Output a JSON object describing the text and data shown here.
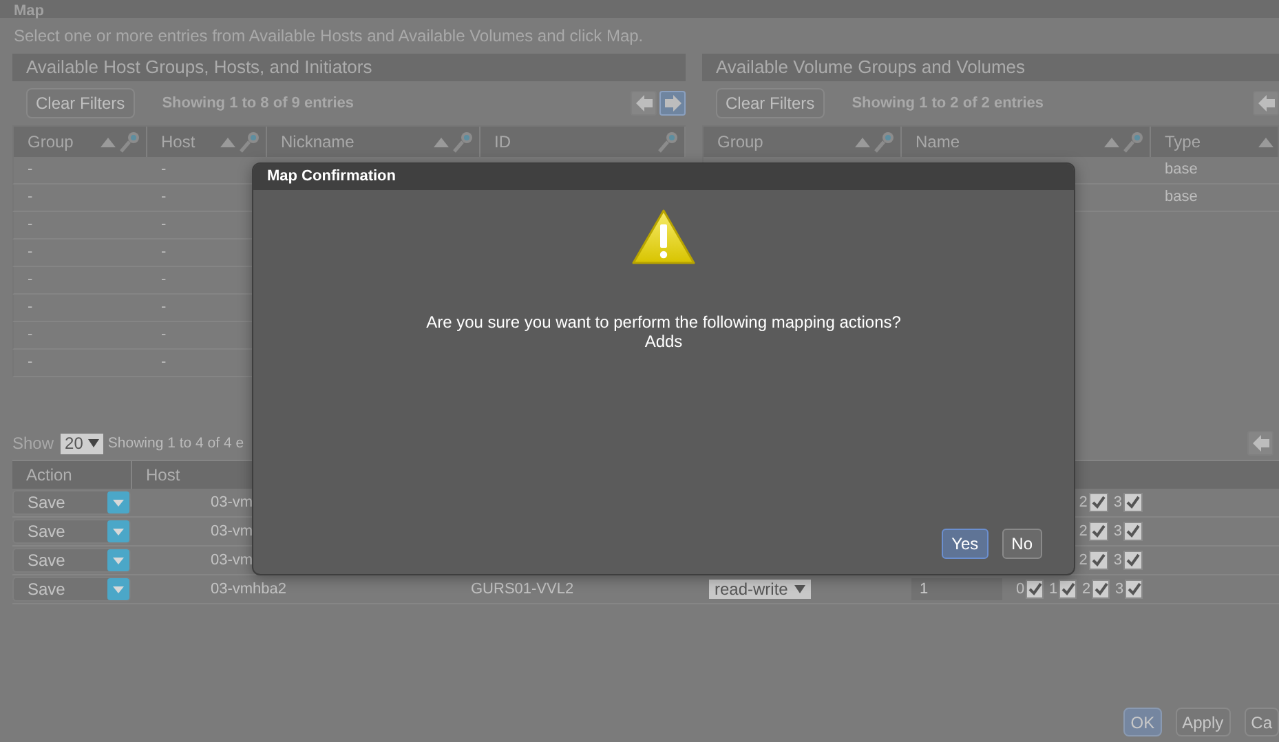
{
  "page": {
    "title": "Map",
    "instructions": "Select one or more entries from Available Hosts and Available Volumes and click Map."
  },
  "host_panel": {
    "title": "Available Host Groups, Hosts, and Initiators",
    "clear_filters": "Clear Filters",
    "info": "Showing 1 to 8 of 9 entries",
    "nav": [
      {
        "kind": "prev",
        "disabled": true
      },
      {
        "kind": "next",
        "disabled": false
      }
    ],
    "columns": [
      {
        "label": "Group",
        "sortable": true,
        "filter": true
      },
      {
        "label": "Host",
        "sortable": true,
        "filter": true
      },
      {
        "label": "Nickname",
        "sortable": true,
        "filter": true
      },
      {
        "label": "ID",
        "sortable": false,
        "filter": true
      }
    ],
    "rows": [
      [
        "-",
        "-"
      ],
      [
        "-",
        "-"
      ],
      [
        "-",
        "-"
      ],
      [
        "-",
        "-"
      ],
      [
        "-",
        "-"
      ],
      [
        "-",
        "-"
      ],
      [
        "-",
        "-"
      ],
      [
        "-",
        "-"
      ]
    ]
  },
  "volume_panel": {
    "title": "Available Volume Groups and Volumes",
    "clear_filters": "Clear Filters",
    "info": "Showing 1 to 2 of 2 entries",
    "nav": [
      {
        "kind": "prev",
        "disabled": true
      }
    ],
    "columns": [
      {
        "label": "Group",
        "sortable": true,
        "filter": true
      },
      {
        "label": "Name",
        "sortable": true,
        "filter": true
      },
      {
        "label": "Type",
        "sortable": true,
        "filter": false
      }
    ],
    "rows": [
      [
        "",
        "",
        "base"
      ],
      [
        "",
        "",
        "base"
      ]
    ]
  },
  "mappings": {
    "show_label": "Show",
    "page_size": "20",
    "info": "Showing 1 to 4 of 4 e",
    "nav": [
      {
        "kind": "prev",
        "disabled": true
      }
    ],
    "columns": [
      "Action",
      "Host"
    ],
    "rows": [
      {
        "action": "Save",
        "host": "03-vm",
        "luns": [
          {
            "label": "2",
            "checked": true
          },
          {
            "label": "3",
            "checked": true
          }
        ]
      },
      {
        "action": "Save",
        "host": "03-vm",
        "luns": [
          {
            "label": "2",
            "checked": true
          },
          {
            "label": "3",
            "checked": true
          }
        ]
      },
      {
        "action": "Save",
        "host": "03-vm",
        "luns": [
          {
            "label": "2",
            "checked": true
          },
          {
            "label": "3",
            "checked": true
          }
        ]
      },
      {
        "action": "Save",
        "host": "03-vmhba2",
        "volume": "GURS01-VVL2",
        "access": "read-write",
        "lun": "1",
        "luns": [
          {
            "label": "0",
            "checked": true
          },
          {
            "label": "1",
            "checked": true
          },
          {
            "label": "2",
            "checked": true
          },
          {
            "label": "3",
            "checked": true
          }
        ]
      }
    ]
  },
  "footer_buttons": [
    {
      "label": "OK",
      "primary": true
    },
    {
      "label": "Apply",
      "primary": false
    },
    {
      "label": "Ca",
      "primary": false
    }
  ],
  "dialog": {
    "title": "Map Confirmation",
    "message": "Are you sure you want to perform the following mapping actions?",
    "detail": "Adds",
    "buttons": [
      {
        "label": "Yes",
        "focused": true
      },
      {
        "label": "No",
        "focused": false
      }
    ]
  }
}
